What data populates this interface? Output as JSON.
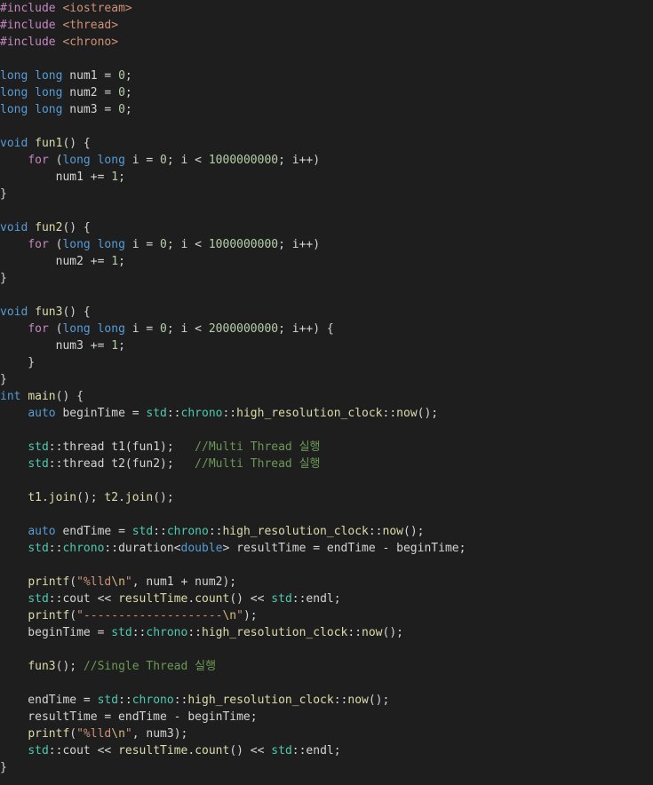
{
  "editor": {
    "language": "cpp",
    "theme_colors": {
      "background": "#1e1e1e",
      "plain": "#d4d4d4",
      "directive": "#c586c0",
      "include": "#ce9178",
      "keyword": "#569cd6",
      "control": "#c586c0",
      "function": "#dcdcaa",
      "number": "#b5cea8",
      "string": "#ce9178",
      "escape": "#d7ba7d",
      "comment": "#6a9955",
      "namespace": "#4ec9b0"
    },
    "lines": [
      [
        {
          "t": "dir",
          "v": "#include"
        },
        {
          "t": "plain",
          "v": " "
        },
        {
          "t": "inc",
          "v": "<iostream>"
        }
      ],
      [
        {
          "t": "dir",
          "v": "#include"
        },
        {
          "t": "plain",
          "v": " "
        },
        {
          "t": "inc",
          "v": "<thread>"
        }
      ],
      [
        {
          "t": "dir",
          "v": "#include"
        },
        {
          "t": "plain",
          "v": " "
        },
        {
          "t": "inc",
          "v": "<chrono>"
        }
      ],
      [],
      [
        {
          "t": "kw",
          "v": "long long"
        },
        {
          "t": "plain",
          "v": " num1 = "
        },
        {
          "t": "num",
          "v": "0"
        },
        {
          "t": "plain",
          "v": ";"
        }
      ],
      [
        {
          "t": "kw",
          "v": "long long"
        },
        {
          "t": "plain",
          "v": " num2 = "
        },
        {
          "t": "num",
          "v": "0"
        },
        {
          "t": "plain",
          "v": ";"
        }
      ],
      [
        {
          "t": "kw",
          "v": "long long"
        },
        {
          "t": "plain",
          "v": " num3 = "
        },
        {
          "t": "num",
          "v": "0"
        },
        {
          "t": "plain",
          "v": ";"
        }
      ],
      [],
      [
        {
          "t": "kw",
          "v": "void"
        },
        {
          "t": "plain",
          "v": " "
        },
        {
          "t": "fn",
          "v": "fun1"
        },
        {
          "t": "plain",
          "v": "() {"
        }
      ],
      [
        {
          "t": "plain",
          "v": "    "
        },
        {
          "t": "ctrl",
          "v": "for"
        },
        {
          "t": "plain",
          "v": " ("
        },
        {
          "t": "kw",
          "v": "long long"
        },
        {
          "t": "plain",
          "v": " i = "
        },
        {
          "t": "num",
          "v": "0"
        },
        {
          "t": "plain",
          "v": "; i < "
        },
        {
          "t": "num",
          "v": "1000000000"
        },
        {
          "t": "plain",
          "v": "; i++)"
        }
      ],
      [
        {
          "t": "plain",
          "v": "        num1 += "
        },
        {
          "t": "num",
          "v": "1"
        },
        {
          "t": "plain",
          "v": ";"
        }
      ],
      [
        {
          "t": "plain",
          "v": "}"
        }
      ],
      [],
      [
        {
          "t": "kw",
          "v": "void"
        },
        {
          "t": "plain",
          "v": " "
        },
        {
          "t": "fn",
          "v": "fun2"
        },
        {
          "t": "plain",
          "v": "() {"
        }
      ],
      [
        {
          "t": "plain",
          "v": "    "
        },
        {
          "t": "ctrl",
          "v": "for"
        },
        {
          "t": "plain",
          "v": " ("
        },
        {
          "t": "kw",
          "v": "long long"
        },
        {
          "t": "plain",
          "v": " i = "
        },
        {
          "t": "num",
          "v": "0"
        },
        {
          "t": "plain",
          "v": "; i < "
        },
        {
          "t": "num",
          "v": "1000000000"
        },
        {
          "t": "plain",
          "v": "; i++)"
        }
      ],
      [
        {
          "t": "plain",
          "v": "        num2 += "
        },
        {
          "t": "num",
          "v": "1"
        },
        {
          "t": "plain",
          "v": ";"
        }
      ],
      [
        {
          "t": "plain",
          "v": "}"
        }
      ],
      [],
      [
        {
          "t": "kw",
          "v": "void"
        },
        {
          "t": "plain",
          "v": " "
        },
        {
          "t": "fn",
          "v": "fun3"
        },
        {
          "t": "plain",
          "v": "() {"
        }
      ],
      [
        {
          "t": "plain",
          "v": "    "
        },
        {
          "t": "ctrl",
          "v": "for"
        },
        {
          "t": "plain",
          "v": " ("
        },
        {
          "t": "kw",
          "v": "long long"
        },
        {
          "t": "plain",
          "v": " i = "
        },
        {
          "t": "num",
          "v": "0"
        },
        {
          "t": "plain",
          "v": "; i < "
        },
        {
          "t": "num",
          "v": "2000000000"
        },
        {
          "t": "plain",
          "v": "; i++) {"
        }
      ],
      [
        {
          "t": "plain",
          "v": "        num3 += "
        },
        {
          "t": "num",
          "v": "1"
        },
        {
          "t": "plain",
          "v": ";"
        }
      ],
      [
        {
          "t": "plain",
          "v": "    }"
        }
      ],
      [
        {
          "t": "plain",
          "v": "}"
        }
      ],
      [
        {
          "t": "kw",
          "v": "int"
        },
        {
          "t": "plain",
          "v": " "
        },
        {
          "t": "fn",
          "v": "main"
        },
        {
          "t": "plain",
          "v": "() {"
        }
      ],
      [
        {
          "t": "plain",
          "v": "    "
        },
        {
          "t": "kw",
          "v": "auto"
        },
        {
          "t": "plain",
          "v": " beginTime = "
        },
        {
          "t": "ns",
          "v": "std"
        },
        {
          "t": "plain",
          "v": "::"
        },
        {
          "t": "ns",
          "v": "chrono"
        },
        {
          "t": "plain",
          "v": "::"
        },
        {
          "t": "fn",
          "v": "high_resolution_clock"
        },
        {
          "t": "plain",
          "v": "::"
        },
        {
          "t": "fn",
          "v": "now"
        },
        {
          "t": "plain",
          "v": "();"
        }
      ],
      [],
      [
        {
          "t": "plain",
          "v": "    "
        },
        {
          "t": "ns",
          "v": "std"
        },
        {
          "t": "plain",
          "v": "::"
        },
        {
          "t": "plain",
          "v": "thread t1(fun1);   "
        },
        {
          "t": "cmt",
          "v": "//Multi Thread 실행"
        }
      ],
      [
        {
          "t": "plain",
          "v": "    "
        },
        {
          "t": "ns",
          "v": "std"
        },
        {
          "t": "plain",
          "v": "::"
        },
        {
          "t": "plain",
          "v": "thread t2(fun2);   "
        },
        {
          "t": "cmt",
          "v": "//Multi Thread 실행"
        }
      ],
      [],
      [
        {
          "t": "plain",
          "v": "    "
        },
        {
          "t": "fn",
          "v": "t1"
        },
        {
          "t": "plain",
          "v": "."
        },
        {
          "t": "fn",
          "v": "join"
        },
        {
          "t": "plain",
          "v": "(); "
        },
        {
          "t": "fn",
          "v": "t2"
        },
        {
          "t": "plain",
          "v": "."
        },
        {
          "t": "fn",
          "v": "join"
        },
        {
          "t": "plain",
          "v": "();"
        }
      ],
      [],
      [
        {
          "t": "plain",
          "v": "    "
        },
        {
          "t": "kw",
          "v": "auto"
        },
        {
          "t": "plain",
          "v": " endTime = "
        },
        {
          "t": "ns",
          "v": "std"
        },
        {
          "t": "plain",
          "v": "::"
        },
        {
          "t": "ns",
          "v": "chrono"
        },
        {
          "t": "plain",
          "v": "::"
        },
        {
          "t": "fn",
          "v": "high_resolution_clock"
        },
        {
          "t": "plain",
          "v": "::"
        },
        {
          "t": "fn",
          "v": "now"
        },
        {
          "t": "plain",
          "v": "();"
        }
      ],
      [
        {
          "t": "plain",
          "v": "    "
        },
        {
          "t": "ns",
          "v": "std"
        },
        {
          "t": "plain",
          "v": "::"
        },
        {
          "t": "ns",
          "v": "chrono"
        },
        {
          "t": "plain",
          "v": "::duration<"
        },
        {
          "t": "kw",
          "v": "double"
        },
        {
          "t": "plain",
          "v": "> resultTime = endTime - beginTime;"
        }
      ],
      [],
      [
        {
          "t": "plain",
          "v": "    "
        },
        {
          "t": "fn",
          "v": "printf"
        },
        {
          "t": "plain",
          "v": "("
        },
        {
          "t": "str",
          "v": "\"%lld"
        },
        {
          "t": "esc",
          "v": "\\n"
        },
        {
          "t": "str",
          "v": "\""
        },
        {
          "t": "plain",
          "v": ", num1 + num2);"
        }
      ],
      [
        {
          "t": "plain",
          "v": "    "
        },
        {
          "t": "ns",
          "v": "std"
        },
        {
          "t": "plain",
          "v": "::cout << "
        },
        {
          "t": "fn",
          "v": "resultTime"
        },
        {
          "t": "plain",
          "v": "."
        },
        {
          "t": "fn",
          "v": "count"
        },
        {
          "t": "plain",
          "v": "() << "
        },
        {
          "t": "ns",
          "v": "std"
        },
        {
          "t": "plain",
          "v": "::endl;"
        }
      ],
      [
        {
          "t": "plain",
          "v": "    "
        },
        {
          "t": "fn",
          "v": "printf"
        },
        {
          "t": "plain",
          "v": "("
        },
        {
          "t": "str",
          "v": "\"--------------------"
        },
        {
          "t": "esc",
          "v": "\\n"
        },
        {
          "t": "str",
          "v": "\""
        },
        {
          "t": "plain",
          "v": ");"
        }
      ],
      [
        {
          "t": "plain",
          "v": "    beginTime = "
        },
        {
          "t": "ns",
          "v": "std"
        },
        {
          "t": "plain",
          "v": "::"
        },
        {
          "t": "ns",
          "v": "chrono"
        },
        {
          "t": "plain",
          "v": "::"
        },
        {
          "t": "fn",
          "v": "high_resolution_clock"
        },
        {
          "t": "plain",
          "v": "::"
        },
        {
          "t": "fn",
          "v": "now"
        },
        {
          "t": "plain",
          "v": "();"
        }
      ],
      [],
      [
        {
          "t": "plain",
          "v": "    "
        },
        {
          "t": "fn",
          "v": "fun3"
        },
        {
          "t": "plain",
          "v": "(); "
        },
        {
          "t": "cmt",
          "v": "//Single Thread 실행"
        }
      ],
      [],
      [
        {
          "t": "plain",
          "v": "    endTime = "
        },
        {
          "t": "ns",
          "v": "std"
        },
        {
          "t": "plain",
          "v": "::"
        },
        {
          "t": "ns",
          "v": "chrono"
        },
        {
          "t": "plain",
          "v": "::"
        },
        {
          "t": "fn",
          "v": "high_resolution_clock"
        },
        {
          "t": "plain",
          "v": "::"
        },
        {
          "t": "fn",
          "v": "now"
        },
        {
          "t": "plain",
          "v": "();"
        }
      ],
      [
        {
          "t": "plain",
          "v": "    resultTime = endTime - beginTime;"
        }
      ],
      [
        {
          "t": "plain",
          "v": "    "
        },
        {
          "t": "fn",
          "v": "printf"
        },
        {
          "t": "plain",
          "v": "("
        },
        {
          "t": "str",
          "v": "\"%lld"
        },
        {
          "t": "esc",
          "v": "\\n"
        },
        {
          "t": "str",
          "v": "\""
        },
        {
          "t": "plain",
          "v": ", num3);"
        }
      ],
      [
        {
          "t": "plain",
          "v": "    "
        },
        {
          "t": "ns",
          "v": "std"
        },
        {
          "t": "plain",
          "v": "::cout << "
        },
        {
          "t": "fn",
          "v": "resultTime"
        },
        {
          "t": "plain",
          "v": "."
        },
        {
          "t": "fn",
          "v": "count"
        },
        {
          "t": "plain",
          "v": "() << "
        },
        {
          "t": "ns",
          "v": "std"
        },
        {
          "t": "plain",
          "v": "::endl;"
        }
      ],
      [
        {
          "t": "plain",
          "v": "}"
        }
      ]
    ]
  }
}
